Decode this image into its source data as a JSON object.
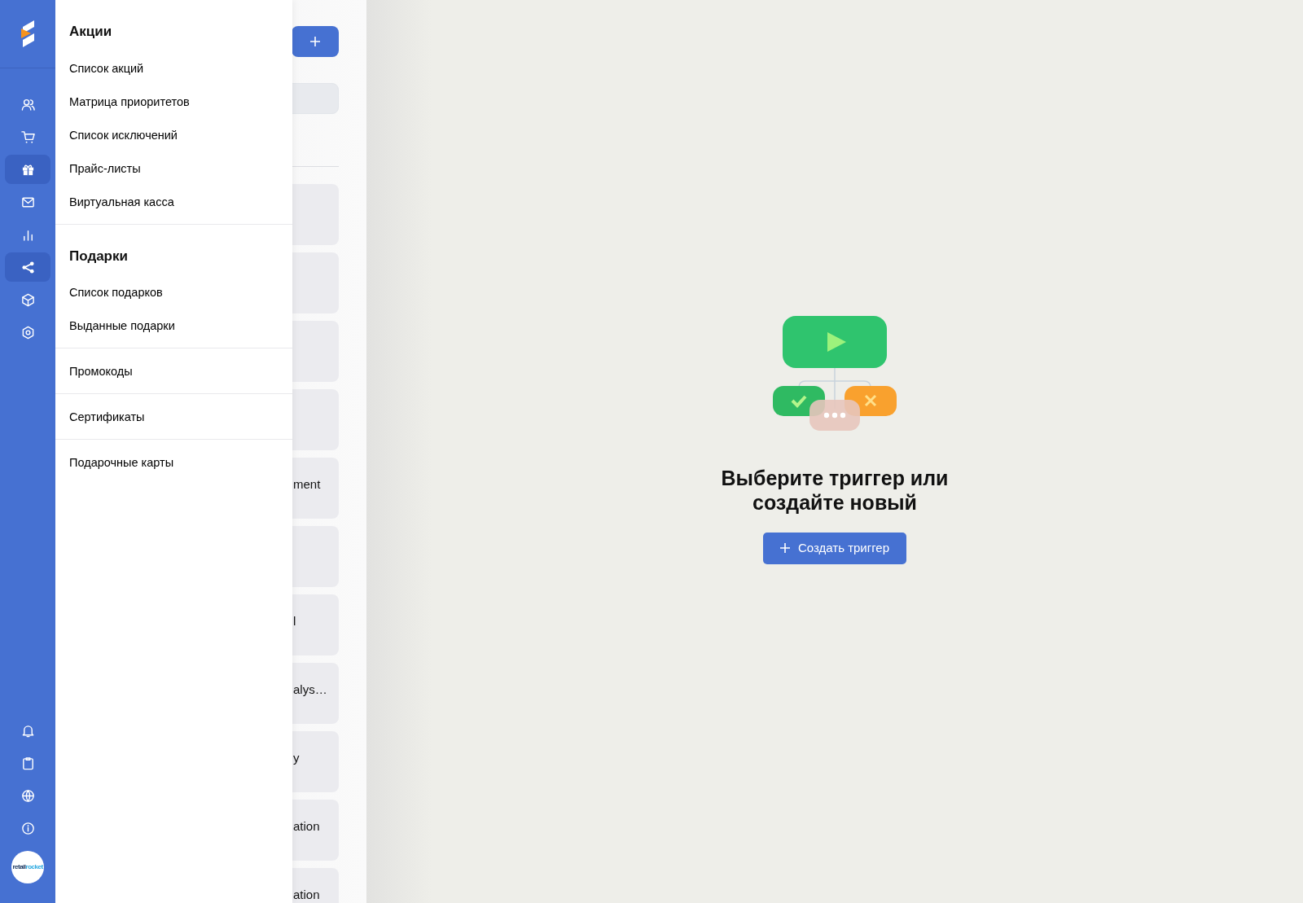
{
  "sidebar": {
    "items": [
      {
        "kind": "users",
        "selected": false
      },
      {
        "kind": "cart",
        "selected": false
      },
      {
        "kind": "gift",
        "selected": true
      },
      {
        "kind": "mail",
        "selected": false
      },
      {
        "kind": "chart",
        "selected": false
      },
      {
        "kind": "share",
        "selected": true
      },
      {
        "kind": "box",
        "selected": false
      },
      {
        "kind": "gear",
        "selected": false
      }
    ],
    "bottom_items": [
      {
        "kind": "bell"
      },
      {
        "kind": "clipboard"
      },
      {
        "kind": "globe"
      },
      {
        "kind": "info"
      }
    ],
    "avatar": {
      "parts": [
        "retail",
        "rocket"
      ]
    }
  },
  "menu": {
    "sections": [
      {
        "title": "Акции",
        "items": [
          "Список акций",
          "Матрица приоритетов",
          "Список исключений",
          "Прайс-листы",
          "Виртуальная касса"
        ]
      },
      {
        "title": "Подарки",
        "items": [
          "Список подарков",
          "Выданные подарки"
        ]
      },
      {
        "items": [
          "Промокоды"
        ]
      },
      {
        "items": [
          "Сертификаты"
        ]
      },
      {
        "items": [
          "Подарочные карты"
        ]
      }
    ]
  },
  "trigger_list": {
    "cards": [
      {
        "kind": "blank"
      },
      {
        "kind": "blank"
      },
      {
        "kind": "blank"
      },
      {
        "kind": "blank"
      },
      {
        "kind": "text",
        "text": "ment"
      },
      {
        "kind": "blank"
      },
      {
        "kind": "text",
        "text": "l"
      },
      {
        "kind": "text",
        "text": "alys…"
      },
      {
        "kind": "text",
        "text": "y"
      },
      {
        "kind": "text",
        "text": "ation"
      },
      {
        "kind": "text",
        "text": "ation"
      }
    ]
  },
  "empty_state": {
    "title": "Выберите триггер или создайте новый",
    "button": "Создать триггер"
  }
}
